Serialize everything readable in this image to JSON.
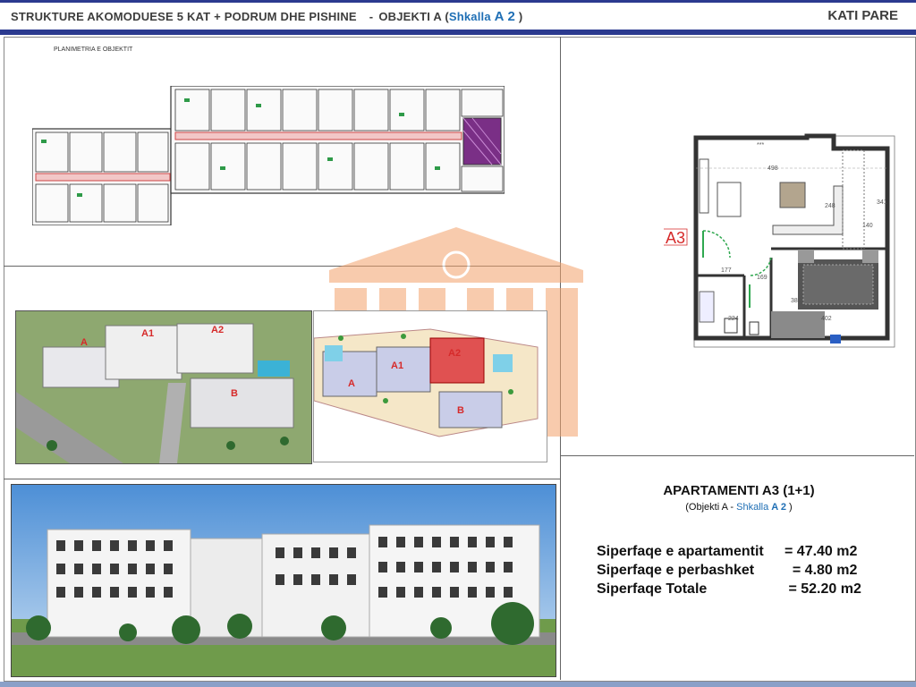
{
  "header": {
    "title_main": "STRUKTURE AKOMODUESE 5 KAT + PODRUM DHE PISHINE",
    "title_sep": "-",
    "title_object": "OBJEKTI A (",
    "title_stair_word": "Shkalla",
    "title_stair_code": "A 2",
    "title_close": ")",
    "floor": "KATI PARE"
  },
  "plan_label": "PLANIMETRIA E OBJEKTIT",
  "aerial_labels": {
    "a": "A",
    "a1": "A1",
    "a2": "A2",
    "b": "B"
  },
  "site_labels": {
    "a": "A",
    "a1": "A1",
    "a2": "A2",
    "b": "B"
  },
  "apartment_plan": {
    "tag": "A3",
    "dims": {
      "d498": "498",
      "d341": "341",
      "d140": "140",
      "d177": "177",
      "d224": "224",
      "d402": "402",
      "d380": "380",
      "d169": "169",
      "d248": "248",
      "stars": "***"
    }
  },
  "info": {
    "title": "APARTAMENTI A3 (1+1)",
    "sub_object": "(Objekti A -",
    "sub_stair_word": "Shkalla",
    "sub_stair_code": "A 2",
    "sub_close": ")",
    "rows": [
      {
        "label": "Siperfaqe e apartamentit",
        "value": "= 47.40 m2"
      },
      {
        "label": "Siperfaqe e perbashket",
        "value": "  = 4.80 m2"
      },
      {
        "label": "Siperfaqe Totale",
        "value": " = 52.20 m2"
      }
    ]
  },
  "colors": {
    "navy": "#2b3a8f",
    "accent_blue": "#1f6fb5",
    "watermark": "#f4a26b",
    "red_tag": "#d62a2a",
    "purple": "#7a2f86"
  }
}
